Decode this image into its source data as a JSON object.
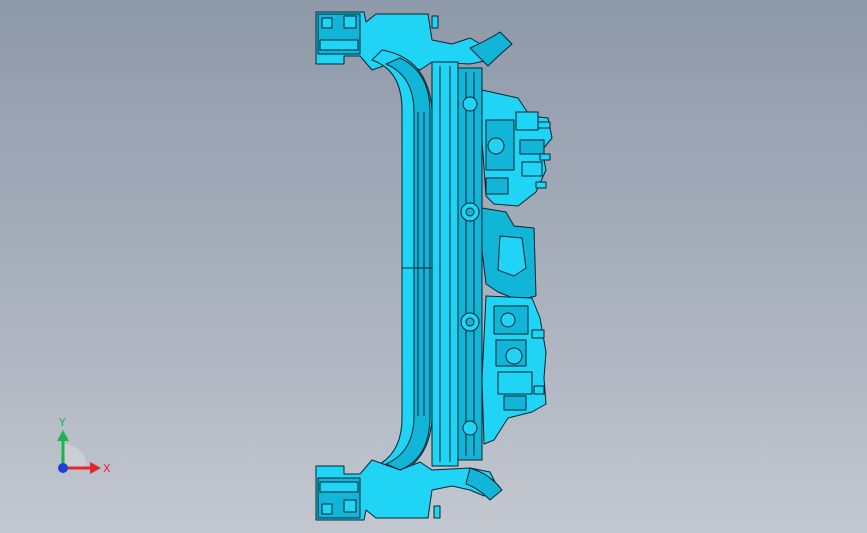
{
  "viewport": {
    "background_top": "#8e99a9",
    "background_bottom": "#c3c8d0"
  },
  "model": {
    "fill_color": "#1fd4f4",
    "fill_dark": "#11b5d8",
    "edge_color": "#0b2430"
  },
  "triad": {
    "x_label": "X",
    "y_label": "Y",
    "x_color": "#e5262a",
    "y_color": "#22b14c",
    "z_color": "#1f3fd8"
  }
}
